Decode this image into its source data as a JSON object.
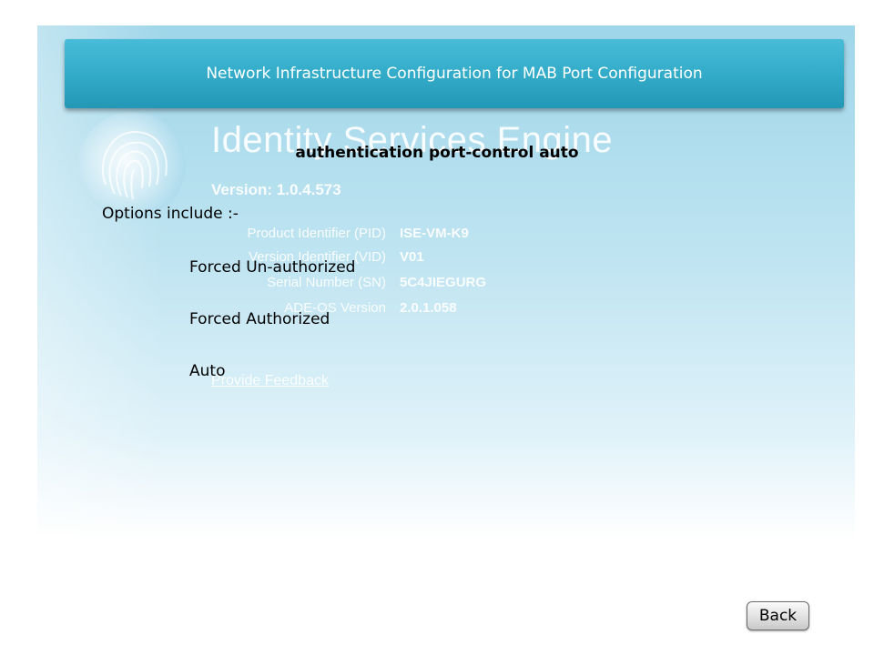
{
  "slide": {
    "title": "Network Infrastructure Configuration for MAB Port Configuration",
    "command": "authentication port-control auto",
    "options_heading": "Options include :-",
    "options": [
      "Forced Un-authorized",
      "Forced Authorized",
      "Auto"
    ],
    "back_label": "Back"
  },
  "background_screenshot": {
    "product_title": "Identity Services Engine",
    "version_line": "Version: 1.0.4.573",
    "info_rows": [
      {
        "label": "Product Identifier (PID)",
        "value": "ISE-VM-K9"
      },
      {
        "label": "Version Identifier (VID)",
        "value": "V01"
      },
      {
        "label": "Serial Number (SN)",
        "value": "5C4JIEGURG"
      },
      {
        "label": "ADE-OS Version",
        "value": "2.0.1.058"
      }
    ],
    "feedback_link": "Provide Feedback"
  },
  "colors": {
    "header_bar": "#33acc9",
    "background_top": "#9fd6e9",
    "background_bottom": "#ffffff"
  },
  "icons": {
    "background_logo": "fingerprint-globe-icon"
  }
}
